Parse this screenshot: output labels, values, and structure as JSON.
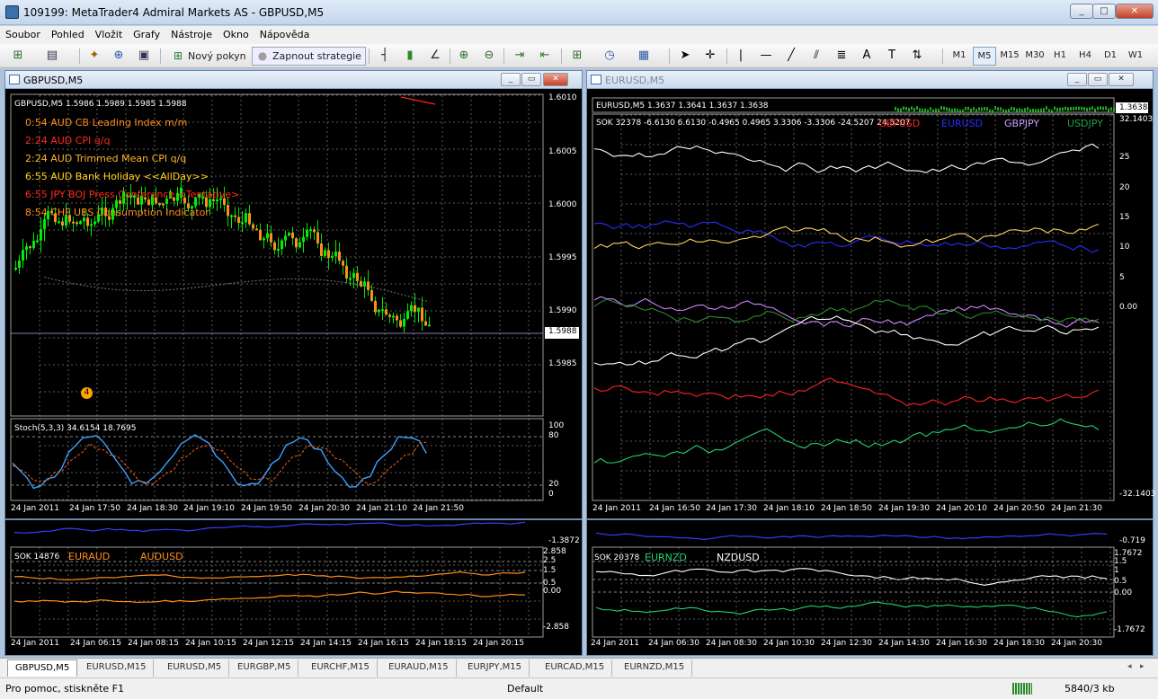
{
  "app": {
    "title": "109199: MetaTrader4 Admiral Markets AS - GBPUSD,M5"
  },
  "menu": [
    "Soubor",
    "Pohled",
    "Vložit",
    "Grafy",
    "Nástroje",
    "Okno",
    "Nápověda"
  ],
  "toolbar": {
    "new_order": "Nový pokyn",
    "strategy": "Zapnout strategie",
    "timeframes": [
      "M1",
      "M5",
      "M15",
      "M30",
      "H1",
      "H4",
      "D1",
      "W1"
    ],
    "selected_tf": "M5"
  },
  "win_gbp": {
    "title": "GBPUSD,M5",
    "quote": "GBPUSD,M5  1.5986 1.5989 1.5985 1.5988",
    "prices": [
      "1.6010",
      "1.6005",
      "1.6000",
      "1.5995",
      "1.5990",
      "1.5988",
      "1.5985"
    ],
    "current_price": "1.5988",
    "news": [
      {
        "text": "0:54  AUD  CB Leading Index m/m",
        "color": "#ff8c1a"
      },
      {
        "text": "2:24  AUD  CPI q/q",
        "color": "#ff2a1a"
      },
      {
        "text": "2:24  AUD  Trimmed Mean CPI q/q",
        "color": "#ffb52a"
      },
      {
        "text": "6:55  AUD  Bank Holiday <<AllDay>>",
        "color": "#ffd21a"
      },
      {
        "text": "6:55  JPY  BOJ Press Conference <Tentative>",
        "color": "#ff2a1a"
      },
      {
        "text": "8:54  CHF  UBS Consumption Indicator",
        "color": "#ff8c1a"
      }
    ],
    "marker": "4",
    "stoch_label": "Stoch(5,3,3) 34.6154 18.7695",
    "stoch_levels": [
      "100",
      "80",
      "20",
      "0"
    ],
    "times": [
      "24 Jan 2011",
      "24 Jan 17:50",
      "24 Jan 18:30",
      "24 Jan 19:10",
      "24 Jan 19:50",
      "24 Jan 20:30",
      "24 Jan 21:10",
      "24 Jan 21:50"
    ]
  },
  "win_eur": {
    "title": "EURUSD,M5",
    "quote": "EURUSD,M5  1.3637 1.3641 1.3637 1.3638",
    "price_box": "1.3638",
    "sok": "SOK 32378 -6.6130 6.6130 -0.4965 0.4965 3.3306 -3.3306 -24.5207 24.5207",
    "legend": [
      {
        "text": "GBPUSD",
        "color": "#ff2020"
      },
      {
        "text": "EURUSD",
        "color": "#2a2aff"
      },
      {
        "text": "GBPJPY",
        "color": "#c8a0ff"
      },
      {
        "text": "USDJPY",
        "color": "#20a040"
      }
    ],
    "scale": [
      "32.1403",
      "25",
      "20",
      "15",
      "10",
      "5",
      "0.00",
      "-32.1403"
    ],
    "times": [
      "24 Jan 2011",
      "24 Jan 16:50",
      "24 Jan 17:30",
      "24 Jan 18:10",
      "24 Jan 18:50",
      "24 Jan 19:30",
      "24 Jan 20:10",
      "24 Jan 20:50",
      "24 Jan 21:30"
    ]
  },
  "win_aud": {
    "top_scale": "-1.3872",
    "sok": "SOK 14876",
    "legend": [
      {
        "text": "EURAUD",
        "color": "#ff8c1a"
      },
      {
        "text": "AUDUSD",
        "color": "#ff8c1a"
      }
    ],
    "scale": [
      "2.858",
      "2.5",
      "1.5",
      "0.5",
      "0.00",
      "-2.858"
    ],
    "times": [
      "24 Jan 2011",
      "24 Jan 06:15",
      "24 Jan 08:15",
      "24 Jan 10:15",
      "24 Jan 12:15",
      "24 Jan 14:15",
      "24 Jan 16:15",
      "24 Jan 18:15",
      "24 Jan 20:15"
    ]
  },
  "win_nzd": {
    "top_scale": "-0.719",
    "sok": "SOK 20378",
    "legend": [
      {
        "text": "EURNZD",
        "color": "#20d070"
      },
      {
        "text": "NZDUSD",
        "color": "#ffffff"
      }
    ],
    "scale": [
      "1.7672",
      "1.5",
      "1",
      "0.5",
      "0.00",
      "-1.7672"
    ],
    "times": [
      "24 Jan 2011",
      "24 Jan 06:30",
      "24 Jan 08:30",
      "24 Jan 10:30",
      "24 Jan 12:30",
      "24 Jan 14:30",
      "24 Jan 16:30",
      "24 Jan 18:30",
      "24 Jan 20:30"
    ]
  },
  "tabs": [
    "GBPUSD,M5",
    "EURUSD,M15",
    "EURUSD,M5",
    "EURGBP,M5",
    "EURCHF,M15",
    "EURAUD,M15",
    "EURJPY,M15",
    "EURCAD,M15",
    "EURNZD,M15"
  ],
  "status": {
    "help": "Pro pomoc, stiskněte F1",
    "profile": "Default",
    "traffic": "5840/3 kb"
  }
}
